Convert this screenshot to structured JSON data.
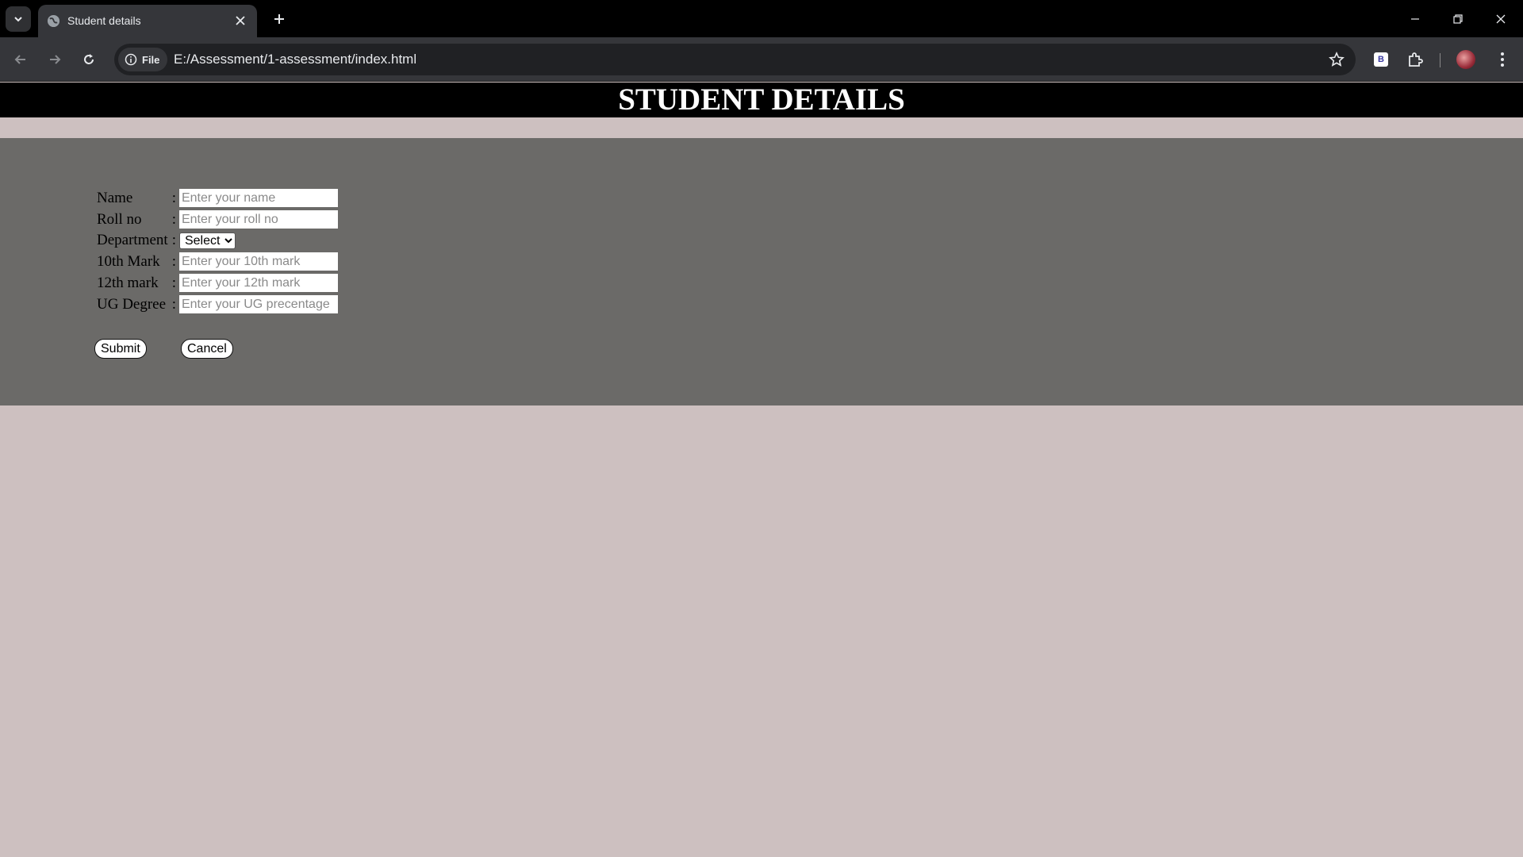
{
  "browser": {
    "tab_title": "Student details",
    "site_chip_label": "File",
    "url": "E:/Assessment/1-assessment/index.html",
    "extension_letter": "B"
  },
  "page": {
    "title": "STUDENT DETAILS",
    "colors": {
      "background": "#cdc0c0",
      "panel": "#6b6a68",
      "header": "#000000"
    }
  },
  "form": {
    "fields": [
      {
        "label": "Name",
        "placeholder": "Enter your name"
      },
      {
        "label": "Roll no",
        "placeholder": "Enter your roll no"
      },
      {
        "label": "Department",
        "selected": "Select"
      },
      {
        "label": "10th Mark",
        "placeholder": "Enter your 10th mark"
      },
      {
        "label": "12th mark",
        "placeholder": "Enter your 12th mark"
      },
      {
        "label": "UG Degree",
        "placeholder": "Enter your UG precentage"
      }
    ],
    "colon": ":",
    "submit_label": "Submit",
    "cancel_label": "Cancel"
  }
}
